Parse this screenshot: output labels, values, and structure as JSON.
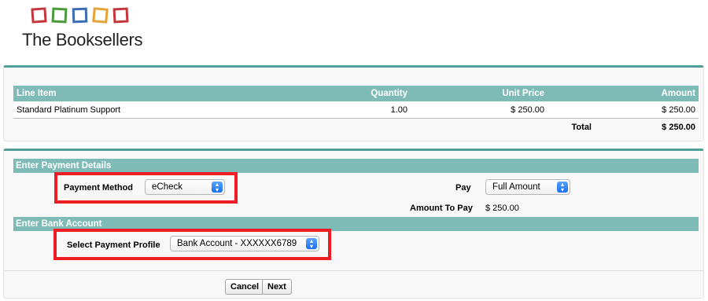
{
  "brand": {
    "name": "The Booksellers",
    "square_colors": [
      "#c4373d",
      "#4a9a3c",
      "#3d6db4",
      "#e3a336",
      "#c4373d"
    ]
  },
  "line_items": {
    "headers": [
      "Line Item",
      "Quantity",
      "Unit Price",
      "Amount"
    ],
    "rows": [
      {
        "item": "Standard Platinum Support",
        "quantity": "1.00",
        "unit_price": "$ 250.00",
        "amount": "$ 250.00"
      }
    ],
    "total_label": "Total",
    "total_value": "$ 250.00"
  },
  "payment": {
    "section_title": "Enter Payment Details",
    "method_label": "Payment Method",
    "method_value": "eCheck",
    "pay_label": "Pay",
    "pay_value": "Full Amount",
    "amount_label": "Amount To Pay",
    "amount_value": "$ 250.00"
  },
  "bank": {
    "section_title": "Enter Bank Account",
    "profile_label": "Select Payment Profile",
    "profile_value": "Bank Account - XXXXXX6789"
  },
  "buttons": {
    "cancel": "Cancel",
    "next": "Next"
  },
  "colors": {
    "accent": "#4f9e98",
    "header_bg": "#7fbbb6",
    "highlight": "#ee1c25"
  }
}
